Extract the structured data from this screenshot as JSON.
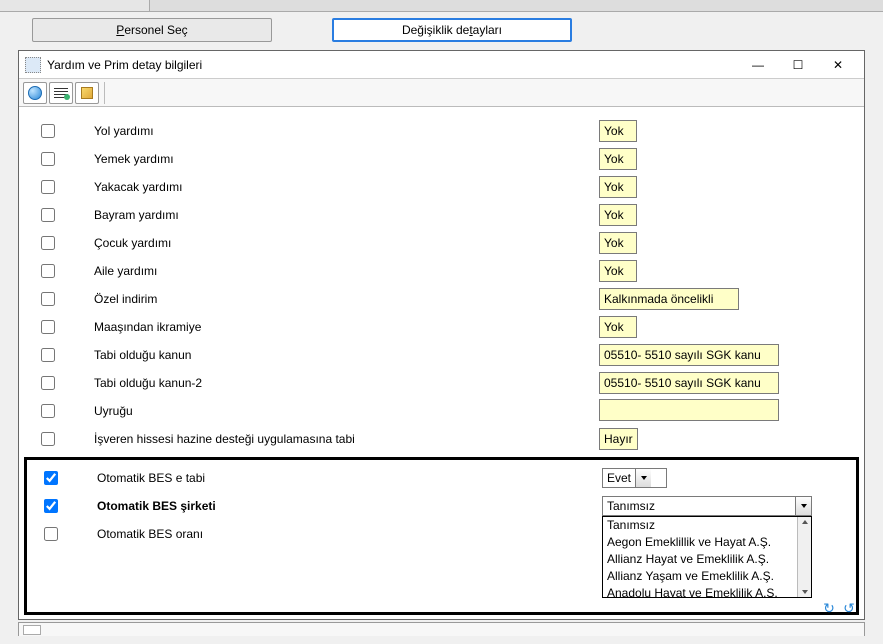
{
  "tabs": {
    "personel_sec": {
      "pre": "",
      "key": "P",
      "post": "ersonel Seç"
    },
    "degisiklik_detaylari": {
      "pre": "Değişiklik de",
      "key": "t",
      "post": "ayları"
    }
  },
  "window_title": "Yardım ve Prim detay bilgileri",
  "rows": {
    "yol": {
      "label": "Yol yardımı",
      "value": "Yok"
    },
    "yemek": {
      "label": "Yemek yardımı",
      "value": "Yok"
    },
    "yakacak": {
      "label": "Yakacak yardımı",
      "value": "Yok"
    },
    "bayram": {
      "label": "Bayram yardımı",
      "value": "Yok"
    },
    "cocuk": {
      "label": "Çocuk yardımı",
      "value": "Yok"
    },
    "aile": {
      "label": "Aile yardımı",
      "value": "Yok"
    },
    "ozel_ind": {
      "label": "Özel indirim",
      "value": "Kalkınmada öncelikli"
    },
    "maas_ikr": {
      "label": "Maaşından ikramiye",
      "value": "Yok"
    },
    "kanun1": {
      "label": "Tabi olduğu kanun",
      "value": "05510-  5510 sayılı SGK kanu"
    },
    "kanun2": {
      "label": "Tabi olduğu kanun-2",
      "value": "05510-  5510 sayılı SGK kanu"
    },
    "uyruk": {
      "label": "Uyruğu",
      "value": ""
    },
    "hazine": {
      "label": "İşveren hissesi hazine desteği uygulamasına tabi",
      "value": "Hayır"
    },
    "bes_tabi": {
      "label": "Otomatik BES e tabi",
      "value": "Evet"
    },
    "bes_sirket": {
      "label": "Otomatik BES şirketi",
      "value": "Tanımsız"
    },
    "bes_oran": {
      "label": "Otomatik BES oranı"
    }
  },
  "dropdown_items": [
    "Tanımsız",
    "Aegon Emeklillik ve Hayat A.Ş.",
    "Allianz Hayat ve Emeklilik A.Ş.",
    "Allianz Yaşam ve Emeklilik A.Ş.",
    "Anadolu Hayat ve Emeklilik A.Ş."
  ],
  "checked": {
    "yol": false,
    "yemek": false,
    "yakacak": false,
    "bayram": false,
    "cocuk": false,
    "aile": false,
    "ozel_ind": false,
    "maas_ikr": false,
    "kanun1": false,
    "kanun2": false,
    "uyruk": false,
    "hazine": false,
    "bes_tabi": true,
    "bes_sirket": true,
    "bes_oran": false
  }
}
